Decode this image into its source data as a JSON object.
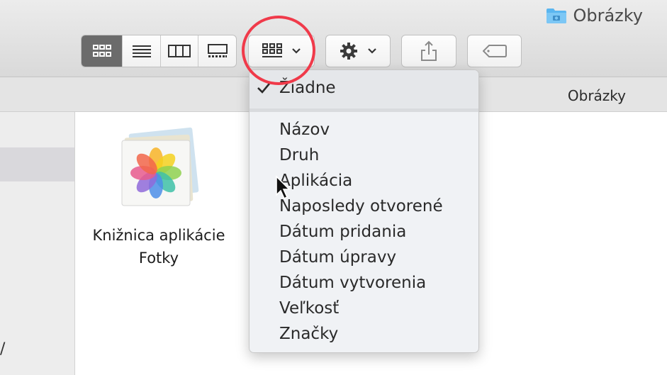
{
  "window": {
    "title": "Obrázky",
    "folder_icon": "folder-pictures-icon"
  },
  "toolbar": {
    "view_modes": [
      {
        "name": "icon-view",
        "icon": "grid-icon",
        "active": true
      },
      {
        "name": "list-view",
        "icon": "list-icon",
        "active": false
      },
      {
        "name": "column-view",
        "icon": "columns-icon",
        "active": false
      },
      {
        "name": "gallery-view",
        "icon": "gallery-icon",
        "active": false
      }
    ],
    "group_button_icon": "group-grid-icon",
    "action_button_icon": "gear-icon",
    "share_button_icon": "share-icon",
    "tag_button_icon": "tag-icon"
  },
  "pathbar": {
    "label": "Obrázky"
  },
  "sidebar": {
    "fragment": "/"
  },
  "file": {
    "name_line1": "Knižnica aplikácie",
    "name_line2": "Fotky"
  },
  "menu": {
    "selected": "Žiadne",
    "items": [
      "Názov",
      "Druh",
      "Aplikácia",
      "Naposledy otvorené",
      "Dátum pridania",
      "Dátum úpravy",
      "Dátum vytvorenia",
      "Veľkosť",
      "Značky"
    ]
  },
  "colors": {
    "highlight": "#f03a4a",
    "active_segment": "#6b6b6b",
    "folder": "#5ab6f0"
  }
}
